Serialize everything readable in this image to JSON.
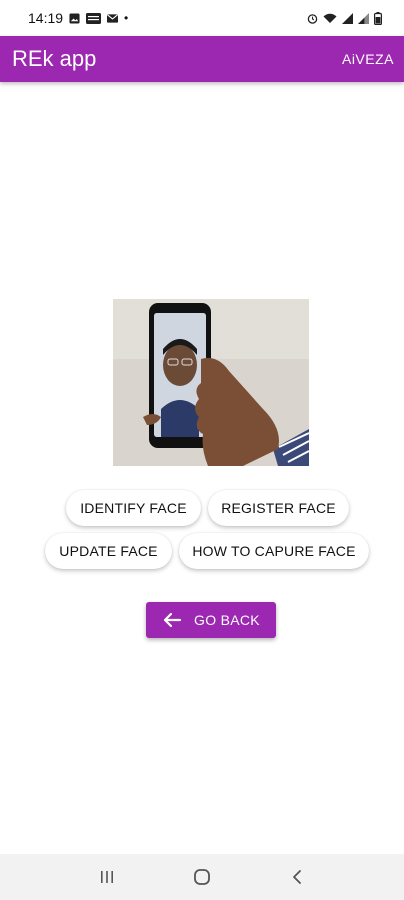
{
  "status_bar": {
    "time": "14:19",
    "dot": "•",
    "icons": [
      "gallery-icon",
      "news-icon",
      "mail-icon",
      "alarm-icon",
      "wifi-icon",
      "signal-icon",
      "signal-icon",
      "battery-icon"
    ]
  },
  "app_bar": {
    "title": "REk app",
    "action_label": "AiVEZA",
    "color": "#9c27b0"
  },
  "photo": {
    "subject": "hand holding phone showing face capture"
  },
  "buttons": {
    "identify": "IDENTIFY FACE",
    "register": "REGISTER FACE",
    "update": "UPDATE FACE",
    "howto": "HOW TO CAPURE FACE",
    "go_back": "GO BACK"
  },
  "nav_bar": {
    "icons": [
      "recents-icon",
      "home-icon",
      "back-icon"
    ]
  }
}
